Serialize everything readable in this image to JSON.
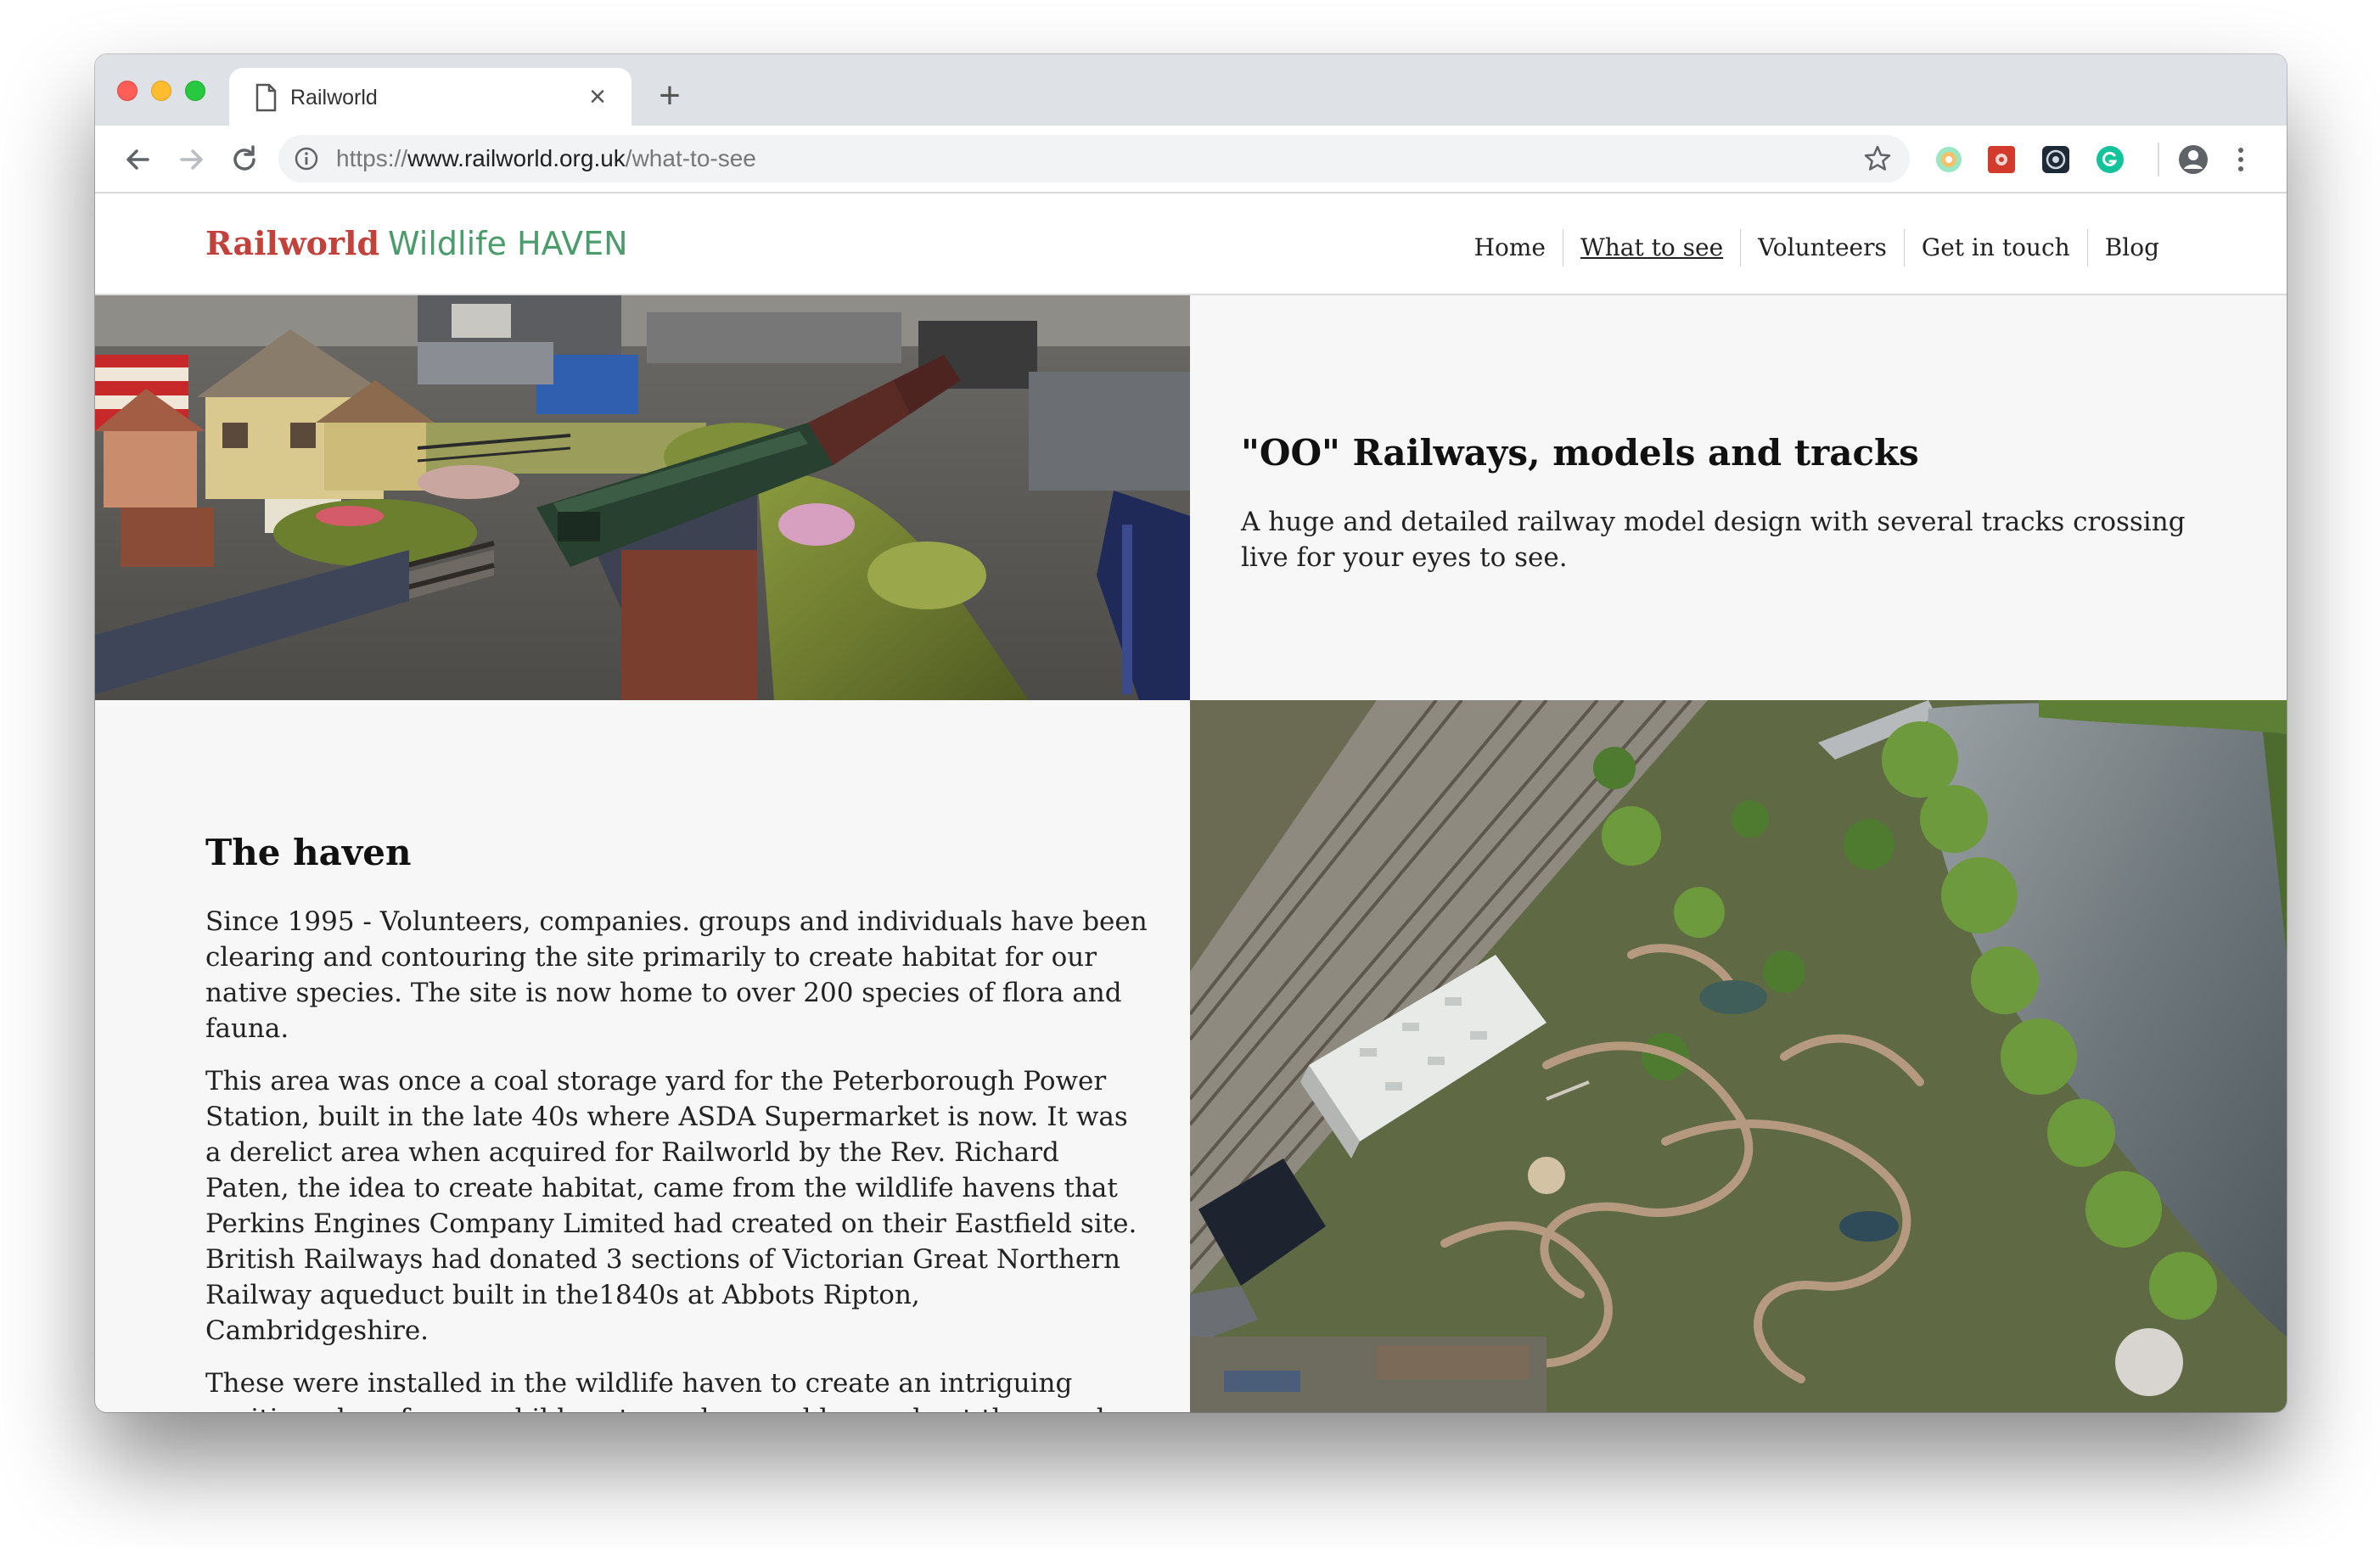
{
  "browser": {
    "tab_title": "Railworld",
    "url_scheme": "https://",
    "url_host": "www.railworld.org.uk",
    "url_path": "/what-to-see",
    "icons": [
      "back-icon",
      "forward-icon",
      "reload-icon",
      "info-icon",
      "star-icon",
      "profile-icon",
      "menu-icon"
    ]
  },
  "site": {
    "logo_primary": "Railworld",
    "logo_secondary": "Wildlife HAVEN",
    "nav": [
      "Home",
      "What to see",
      "Volunteers",
      "Get in touch",
      "Blog"
    ],
    "active_nav": "What to see"
  },
  "sections": {
    "railways": {
      "heading": "\"OO\" Railways, models and tracks",
      "body": "A huge and detailed railway model design with several tracks crossing live for your eyes to see."
    },
    "haven": {
      "heading": "The haven",
      "paragraphs": [
        "Since 1995 - Volunteers, companies. groups and individuals have been clearing and contouring the site primarily to create habitat for our native species. The site is now home to over 200 species of flora and fauna.",
        "This area was once a coal storage yard for the Peterborough Power Station, built in the late 40s where ASDA Supermarket is now. It was a derelict area when acquired for Railworld by the Rev. Richard Paten, the idea to create habitat, came from the wildlife havens that Perkins Engines Company Limited had created on their Eastfield site. British Railways had donated 3 sections of Victorian Great Northern Railway aqueduct built in the1840s at Abbots Ripton, Cambridgeshire.",
        "These were installed in the wildlife haven to create an intriguing exciting place for our children to explore and learn about the wonders of"
      ]
    }
  },
  "colors": {
    "logo_red": "#c2413b",
    "logo_green": "#4a9d6b",
    "text_panel_bg": "#f7f7f7"
  }
}
